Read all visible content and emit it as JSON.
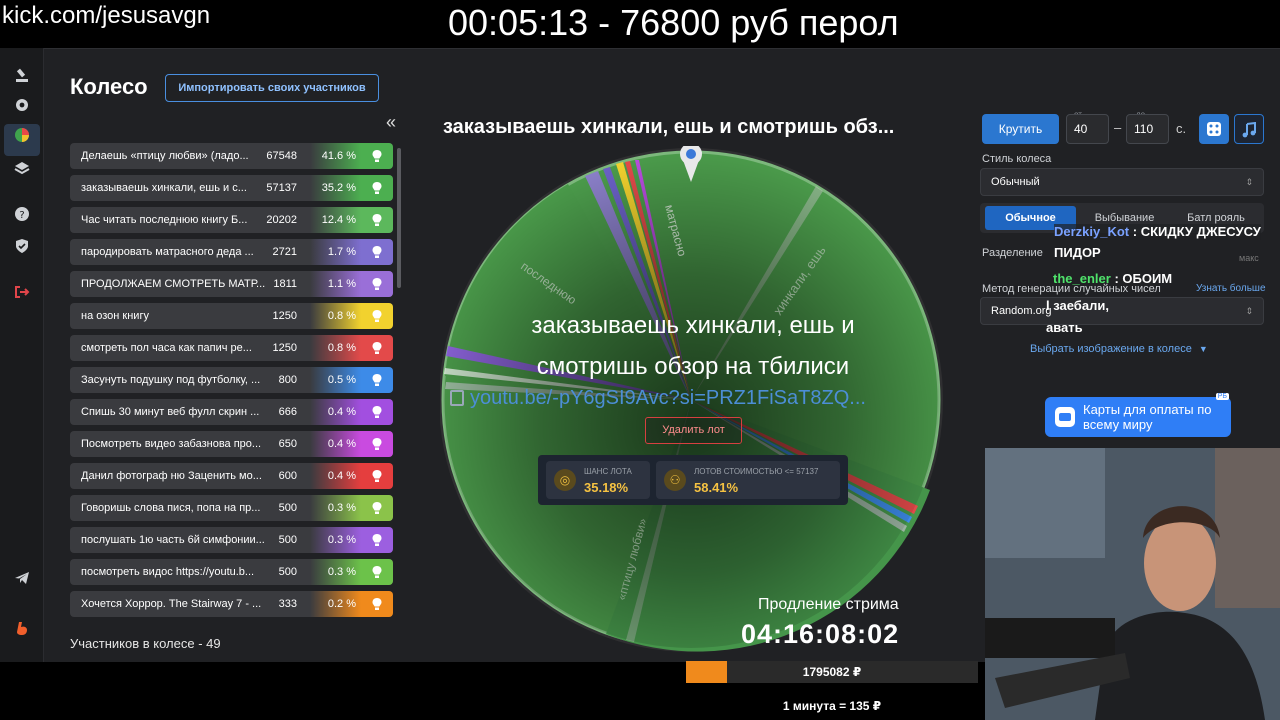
{
  "overlay": {
    "url": "kick.com/jesusavgn",
    "timer_text": "00:05:13 - 76800 руб перол"
  },
  "sidebar_icons": [
    "gavel-icon",
    "gear-icon",
    "pie-chart-icon",
    "layers-icon",
    "help-icon",
    "shield-icon",
    "logout-icon",
    "telegram-icon",
    "boosty-icon"
  ],
  "panel": {
    "title": "Колесо",
    "import_label": "Импортировать своих участников",
    "collapse_label": "«",
    "participants_count": "Участников в колесе - 49"
  },
  "participants": [
    {
      "name": "Делаешь «птицу любви» (ладо...",
      "amount": "67548",
      "percent": "41.6 %",
      "color": "#4caf50"
    },
    {
      "name": "заказываешь хинкали, ешь и с...",
      "amount": "57137",
      "percent": "35.2 %",
      "color": "#4caf50"
    },
    {
      "name": "Час читать последнюю книгу Б...",
      "amount": "20202",
      "percent": "12.4 %",
      "color": "#5cb85c"
    },
    {
      "name": "пародировать матрасного деда ...",
      "amount": "2721",
      "percent": "1.7 %",
      "color": "#7e6fd0"
    },
    {
      "name": "ПРОДОЛЖАЕМ СМОТРЕТЬ МАТР...",
      "amount": "1811",
      "percent": "1.1 %",
      "color": "#9a6fd8"
    },
    {
      "name": "на озон книгу",
      "amount": "1250",
      "percent": "0.8 %",
      "color": "#f2d22e"
    },
    {
      "name": "смотреть пол часа как папич ре...",
      "amount": "1250",
      "percent": "0.8 %",
      "color": "#e34a4a"
    },
    {
      "name": "Засунуть подушку под футболку, ...",
      "amount": "800",
      "percent": "0.5 %",
      "color": "#3d8be8"
    },
    {
      "name": "Спишь 30 минут веб фулл скрин ...",
      "amount": "666",
      "percent": "0.4 %",
      "color": "#a24fe0"
    },
    {
      "name": "Посмотреть видео забазнова про...",
      "amount": "650",
      "percent": "0.4 %",
      "color": "#c94be0"
    },
    {
      "name": "Данил фотограф ню Заценить мо...",
      "amount": "600",
      "percent": "0.4 %",
      "color": "#e53e3e"
    },
    {
      "name": "Говоришь слова пися, попа на пр...",
      "amount": "500",
      "percent": "0.3 %",
      "color": "#8bc34a"
    },
    {
      "name": "послушать 1ю часть 6й симфонии...",
      "amount": "500",
      "percent": "0.3 %",
      "color": "#9c5fe0"
    },
    {
      "name": "посмотреть видос https://youtu.b...",
      "amount": "500",
      "percent": "0.3 %",
      "color": "#6cc24a"
    },
    {
      "name": "Хочется Хоррор. The Stairway 7 - ...",
      "amount": "333",
      "percent": "0.2 %",
      "color": "#f08a1c"
    }
  ],
  "wheel": {
    "current_title": "заказываешь хинкали, ешь и смотришь обз...",
    "winner_text": "заказываешь хинкали, ешь и смотришь обзор на тбилиси",
    "winner_link": "youtu.be/-pY6gSI9Avc?si=PRZ1FiSaT8ZQ...",
    "delete_label": "Удалить лот",
    "stat1_label": "ШАНС ЛОТА",
    "stat1_value": "35.18%",
    "stat2_label": "ЛОТОВ СТОИМОСТЬЮ <= 57137",
    "stat2_value": "58.41%",
    "slice_text_1": "«птицу любви»",
    "slice_text_2": "матрасно",
    "slice_text_3": "последнюю",
    "slice_text_4": "хинкали, ешь",
    "extension_label": "Продление стрима",
    "extension_timer": "04:16:08:02",
    "colors": {
      "main": "#3e8a3e",
      "secondary": "#4a9c4a"
    }
  },
  "controls": {
    "spin_label": "Крутить",
    "from_label": "от",
    "from_value": "40",
    "to_label": "до",
    "to_value": "110",
    "dash": "–",
    "seconds": "с.",
    "dice_icon": "dice-icon",
    "music_icon": "music-icon",
    "style_label": "Стиль колеса",
    "style_value": "Обычный",
    "modes": [
      "Обычное",
      "Выбывание",
      "Батл рояль"
    ],
    "split_label": "Разделение",
    "max_label": "макс",
    "method_label": "Метод генерации случайных чисел",
    "learn_more": "Узнать больше",
    "method_value": "Random.org",
    "choose_image": "Выбрать изображение в колесе"
  },
  "chat": {
    "msg1_user": "Derzkiy_Kot",
    "msg1_text": ": СКИДКУ ДЖЕСУСУ",
    "msg1_cont": "ПИДОР",
    "msg2_user": "the_enler",
    "msg2_text": ": ОБОИМ",
    "msg3": "l заебали,",
    "msg4": "авать"
  },
  "promo": {
    "text": "Карты для оплаты по всему миру",
    "badge": "РБ"
  },
  "donation": {
    "amount": "1795082 ₽",
    "progress": 0.14,
    "rate": "1 минута = 135 ₽"
  }
}
